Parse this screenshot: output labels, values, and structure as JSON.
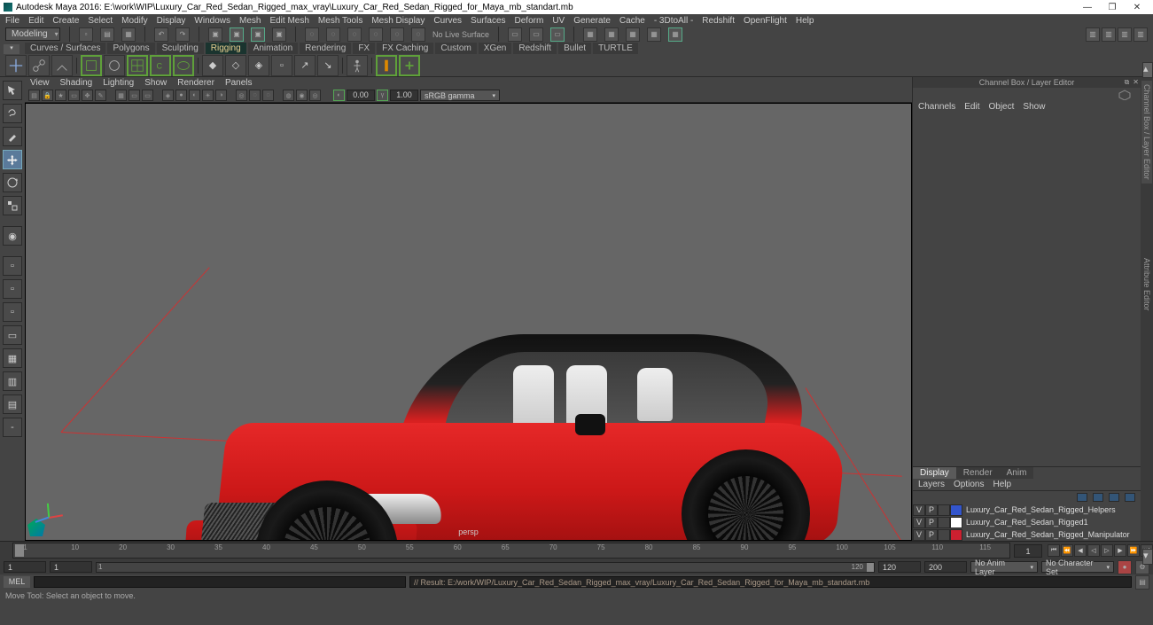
{
  "title": "Autodesk Maya 2016: E:\\work\\WIP\\Luxury_Car_Red_Sedan_Rigged_max_vray\\Luxury_Car_Red_Sedan_Rigged_for_Maya_mb_standart.mb",
  "menubar": [
    "File",
    "Edit",
    "Create",
    "Select",
    "Modify",
    "Display",
    "Windows",
    "Mesh",
    "Edit Mesh",
    "Mesh Tools",
    "Mesh Display",
    "Curves",
    "Surfaces",
    "Deform",
    "UV",
    "Generate",
    "Cache",
    "- 3DtoAll -",
    "Redshift",
    "OpenFlight",
    "Help"
  ],
  "workspace_mode": "Modeling",
  "no_live_surface": "No Live Surface",
  "shelf_tabs": [
    "Curves / Surfaces",
    "Polygons",
    "Sculpting",
    "Rigging",
    "Animation",
    "Rendering",
    "FX",
    "FX Caching",
    "Custom",
    "XGen",
    "Redshift",
    "Bullet",
    "TURTLE"
  ],
  "shelf_active": "Rigging",
  "vp_menu": [
    "View",
    "Shading",
    "Lighting",
    "Show",
    "Renderer",
    "Panels"
  ],
  "exposure": "0.00",
  "gamma": "1.00",
  "colorspace": "sRGB gamma",
  "channelbox_title": "Channel Box / Layer Editor",
  "cb_menu": [
    "Channels",
    "Edit",
    "Object",
    "Show"
  ],
  "layer_tabs": [
    "Display",
    "Render",
    "Anim"
  ],
  "layer_menu": [
    "Layers",
    "Options",
    "Help"
  ],
  "layers": [
    {
      "v": "V",
      "p": "P",
      "color": "#3355cc",
      "name": "Luxury_Car_Red_Sedan_Rigged_Helpers"
    },
    {
      "v": "V",
      "p": "P",
      "color": "#ffffff",
      "name": "Luxury_Car_Red_Sedan_Rigged1"
    },
    {
      "v": "V",
      "p": "P",
      "color": "#cc2030",
      "name": "Luxury_Car_Red_Sedan_Rigged_Manipulator"
    }
  ],
  "side_tabs": [
    "Channel Box / Layer Editor",
    "Attribute Editor"
  ],
  "timeline_ticks": [
    "1",
    "10",
    "20",
    "30",
    "35",
    "40",
    "45",
    "50",
    "55",
    "60",
    "65",
    "70",
    "75",
    "80",
    "85",
    "90",
    "95",
    "100",
    "105",
    "110",
    "115"
  ],
  "timeline_end": "1",
  "range_start1": "1",
  "range_start2": "1",
  "range_cur": "1",
  "range_end1": "120",
  "range_end2": "120",
  "range_end3": "200",
  "anim_layer": "No Anim Layer",
  "char_set": "No Character Set",
  "mel": "MEL",
  "result": "// Result: E:/work/WIP/Luxury_Car_Red_Sedan_Rigged_max_vray/Luxury_Car_Red_Sedan_Rigged_for_Maya_mb_standart.mb",
  "helpline": "Move Tool: Select an object to move.",
  "persp": "persp"
}
